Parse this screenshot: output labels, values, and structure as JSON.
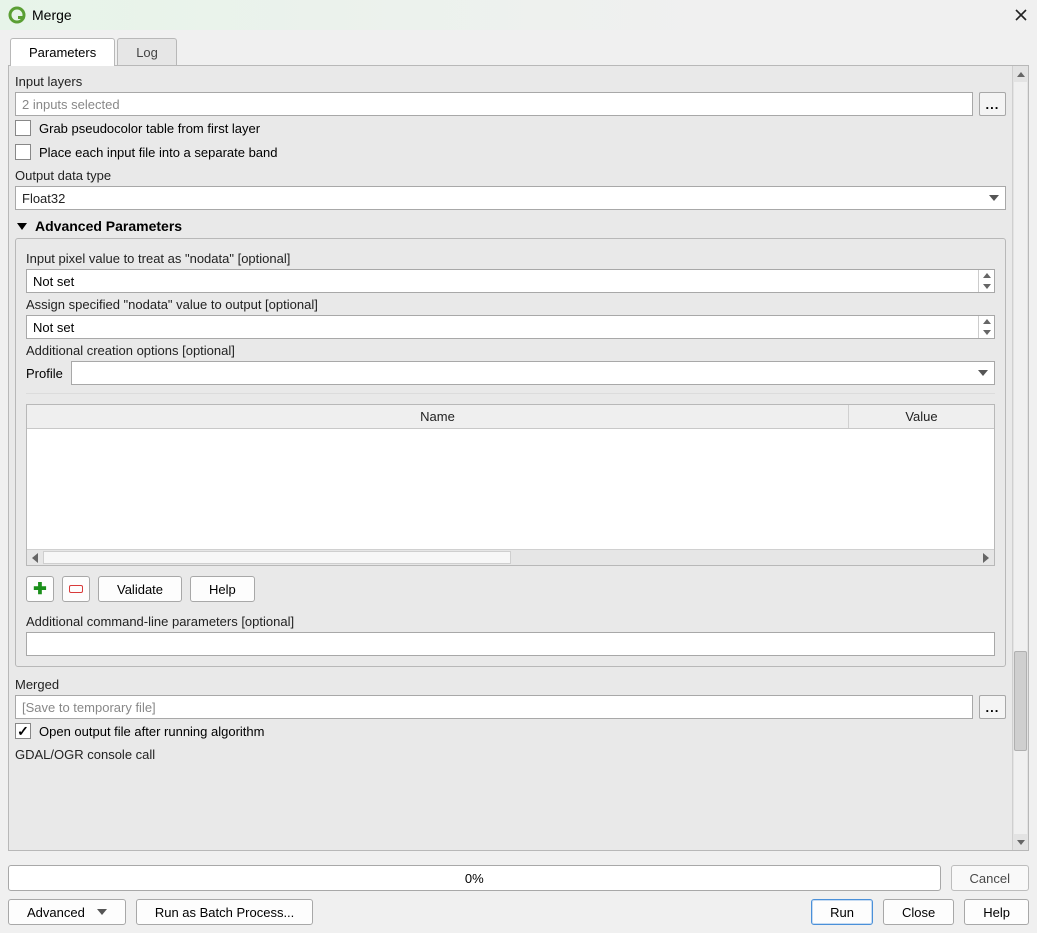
{
  "window": {
    "title": "Merge"
  },
  "tabs": {
    "parameters": "Parameters",
    "log": "Log"
  },
  "labels": {
    "input_layers": "Input layers",
    "output_data_type": "Output data type",
    "advanced_header": "Advanced Parameters",
    "input_nodata": "Input pixel value to treat as \"nodata\" [optional]",
    "assign_nodata": "Assign specified \"nodata\" value to output [optional]",
    "additional_creation": "Additional creation options [optional]",
    "profile": "Profile",
    "additional_cmd": "Additional command-line parameters [optional]",
    "merged": "Merged",
    "gdal_call": "GDAL/OGR console call"
  },
  "inputs": {
    "layers_placeholder": "2 inputs selected",
    "pseudocolor": "Grab pseudocolor table from first layer",
    "separate_band": "Place each input file into a separate band",
    "output_type_value": "Float32",
    "nodata_in_value": "Not set",
    "nodata_out_value": "Not set",
    "merged_placeholder": "[Save to temporary file]",
    "open_output": "Open output file after running algorithm",
    "browse_ellipsis": "..."
  },
  "table": {
    "name_header": "Name",
    "value_header": "Value"
  },
  "buttons": {
    "validate": "Validate",
    "help_small": "Help",
    "advanced": "Advanced",
    "batch": "Run as Batch Process...",
    "run": "Run",
    "close": "Close",
    "help": "Help",
    "cancel": "Cancel"
  },
  "progress": {
    "text": "0%"
  }
}
